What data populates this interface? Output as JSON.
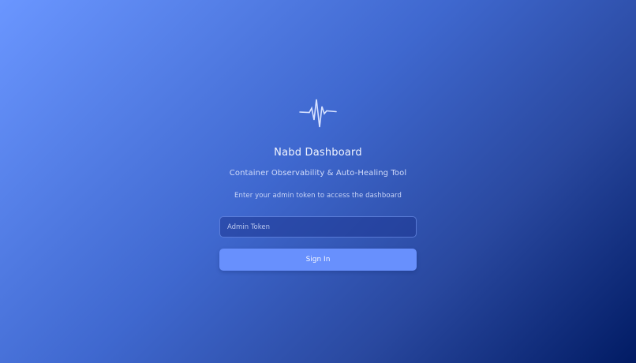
{
  "app": {
    "title": "Nabd Dashboard",
    "subtitle": "Container Observability & Auto-Healing Tool",
    "instruction": "Enter your admin token to access the dashboard"
  },
  "logo": {
    "icon": "heartbeat-pulse-icon",
    "color": "#d8e2ff"
  },
  "form": {
    "token_placeholder": "Admin Token",
    "token_value": "",
    "submit_label": "Sign In"
  },
  "colors": {
    "gradient_start": "#6a96ff",
    "gradient_end": "#011b64",
    "button": "#6890fd"
  }
}
